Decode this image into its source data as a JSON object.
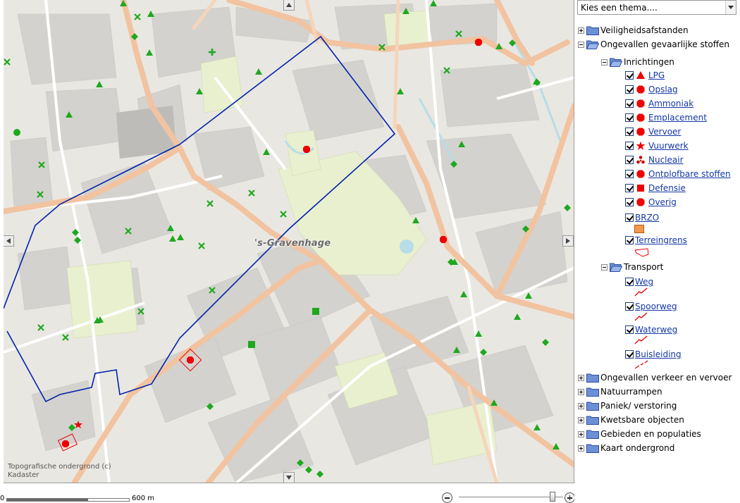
{
  "map": {
    "place_label": "'s-Gravenhage",
    "attribution": "Topografische ondergrond (c) Kadaster",
    "colors": {
      "background": "#e9e7e2",
      "block": "#d3d2ce",
      "park": "#e9f0cf",
      "water": "#b6dde8",
      "main_road": "#f2c3a0",
      "boundary": "#0022aa",
      "marker_green": "#1fa81f",
      "marker_red": "#ee0000"
    }
  },
  "scalebar": {
    "start": "0",
    "end": "600 m"
  },
  "zoom": {
    "level": 0.9
  },
  "theme_select": {
    "placeholder": "Kies een thema...."
  },
  "tree": {
    "veiligheid": "Veiligheidsafstanden",
    "ongevallen_stoffen": "Ongevallen gevaarlijke stoffen",
    "inrichtingen": "Inrichtingen",
    "layers": [
      "LPG",
      "Opslag",
      "Ammoniak",
      "Emplacement",
      "Vervoer",
      "Vuurwerk",
      "Nucleair",
      "Ontplofbare stoffen",
      "Defensie",
      "Overig"
    ],
    "brzo": "BRZO",
    "terreingrens": "Terreingrens",
    "transport": "Transport",
    "transport_layers": [
      "Weg",
      "Spoorweg",
      "Waterweg",
      "Buisleiding"
    ],
    "other_themes": [
      "Ongevallen verkeer en vervoer",
      "Natuurrampen",
      "Paniek/ verstoring",
      "Kwetsbare objecten",
      "Gebieden en populaties",
      "Kaart ondergrond"
    ]
  }
}
